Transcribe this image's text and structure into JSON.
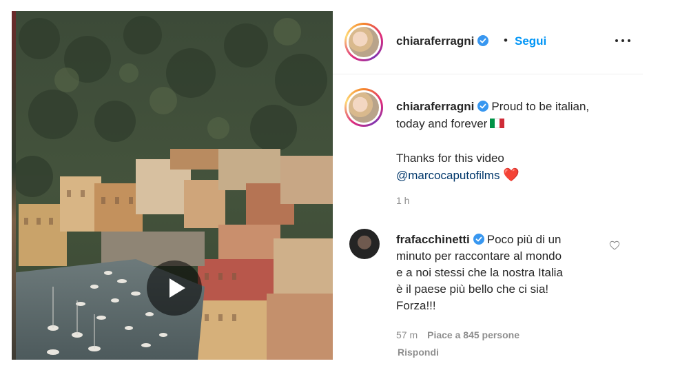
{
  "post": {
    "video": {
      "play_icon": "play-icon"
    },
    "header": {
      "username": "chiaraferragni",
      "verified_icon": "verified-badge-icon",
      "separator": "•",
      "follow_label": "Segui",
      "more_icon": "more-options-icon"
    },
    "caption": {
      "username": "chiaraferragni",
      "line1": "Proud to be italian,",
      "line2": "today and forever",
      "flag_emoji": "🇮🇹",
      "line3": "Thanks for this video",
      "mention": "@marcocaputofilms",
      "heart_emoji": "❤️",
      "time": "1 h"
    },
    "comments": [
      {
        "username": "frafacchinetti",
        "text_line1": "Poco più di un",
        "text_line2": "minuto per raccontare al mondo",
        "text_line3": "e a noi stessi che la nostra Italia",
        "text_line4": "è il paese più bello che ci sia!",
        "text_line5": "Forza!!!",
        "time": "57 m",
        "likes": "Piace a 845 persone",
        "reply_label": "Rispondi",
        "like_icon": "heart-outline-icon"
      }
    ]
  },
  "colors": {
    "accent_blue": "#0095f6",
    "mention_blue": "#00376b",
    "verified_blue": "#3897f0",
    "muted_text": "#8e8e8e",
    "text": "#262626"
  }
}
